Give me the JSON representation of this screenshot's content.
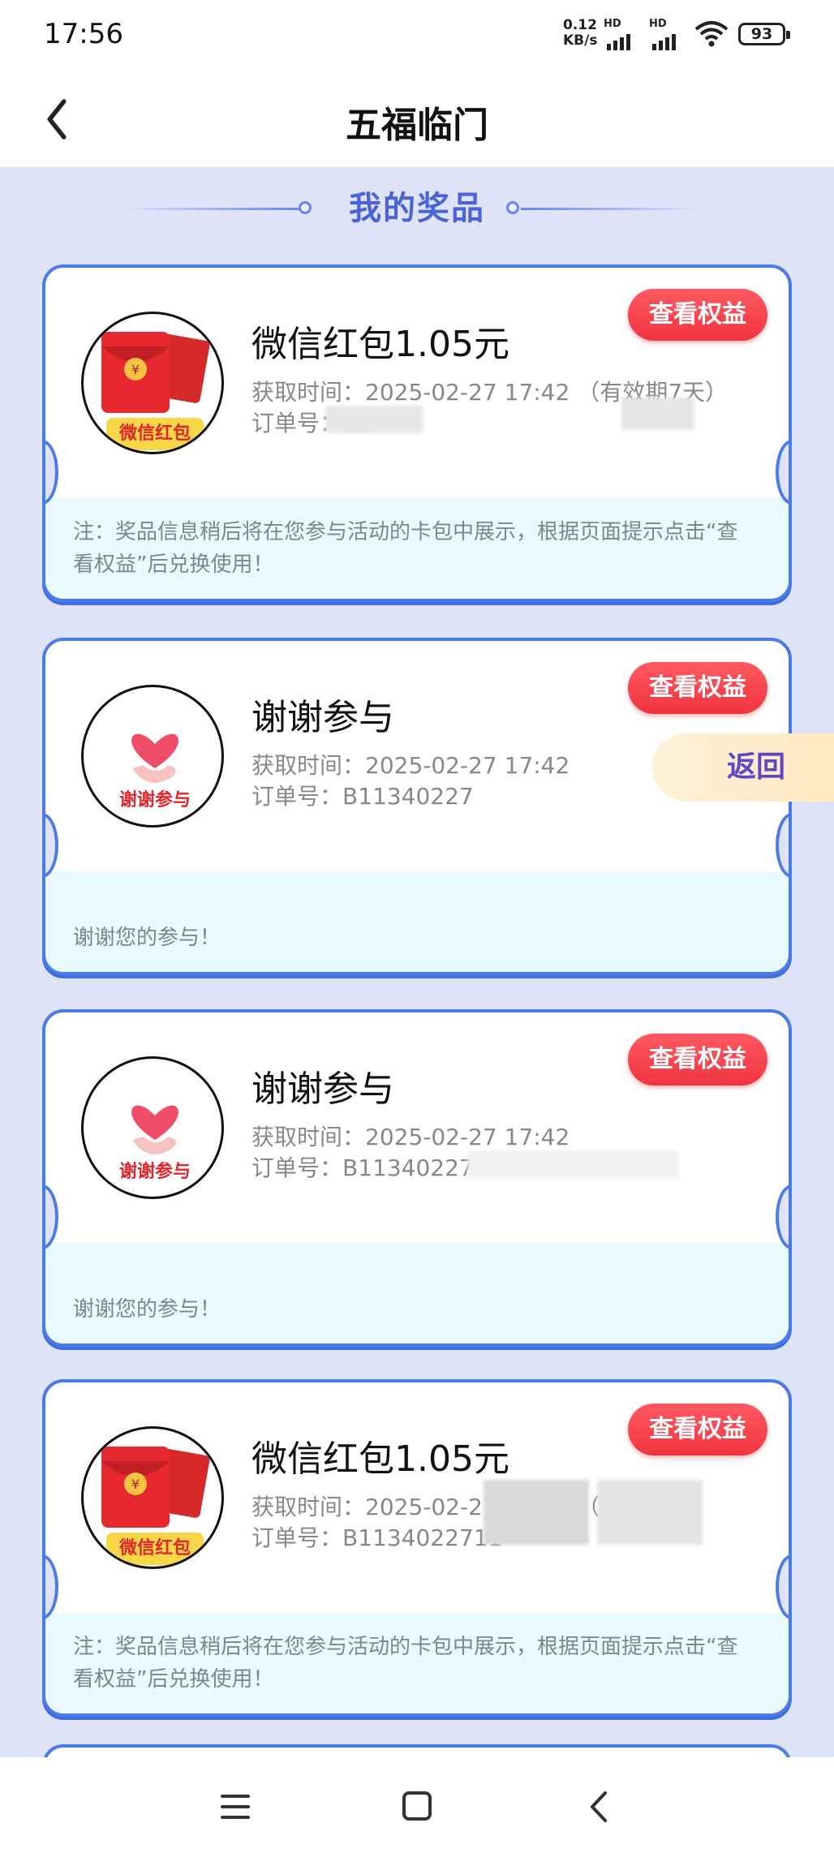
{
  "status_bar": {
    "time": "17:56",
    "net_speed_top": "0.12",
    "net_speed_unit": "KB/s",
    "hd1": "HD",
    "hd2": "HD",
    "battery": "93"
  },
  "header": {
    "title": "五福临门"
  },
  "section": {
    "title": "我的奖品"
  },
  "float_back": {
    "label": "返回"
  },
  "cards": [
    {
      "prize": "微信红包1.05元",
      "badge": "微信红包",
      "time": "获取时间：2025-02-27 17:42 （有效期7天）",
      "order": "订单号：B1",
      "button": "查看权益",
      "note": "注：奖品信息稍后将在您参与活动的卡包中展示，根据页面提示点击“查看权益”后兑换使用！"
    },
    {
      "prize": "谢谢参与",
      "badge": "谢谢参与",
      "time": "获取时间：2025-02-27 17:42",
      "order": "订单号：B11340227",
      "button": "查看权益",
      "note": "谢谢您的参与！"
    },
    {
      "prize": "谢谢参与",
      "badge": "谢谢参与",
      "time": "获取时间：2025-02-27 17:42",
      "order": "订单号：B11340227",
      "button": "查看权益",
      "note": "谢谢您的参与！"
    },
    {
      "prize": "微信红包1.05元",
      "badge": "微信红包",
      "time": "获取时间：2025-02-27 17:42 （有效期",
      "order": "订单号：B1134022711",
      "button": "查看权益",
      "note": "注：奖品信息稍后将在您参与活动的卡包中展示，根据页面提示点击“查看权益”后兑换使用！"
    }
  ],
  "colors": {
    "accent": "#4a7be6",
    "button": "#f0343f",
    "section_title": "#4a63d8",
    "page_bg": "#dfe3f7"
  },
  "nav_icons": [
    "menu-icon",
    "home-icon",
    "back-icon"
  ]
}
